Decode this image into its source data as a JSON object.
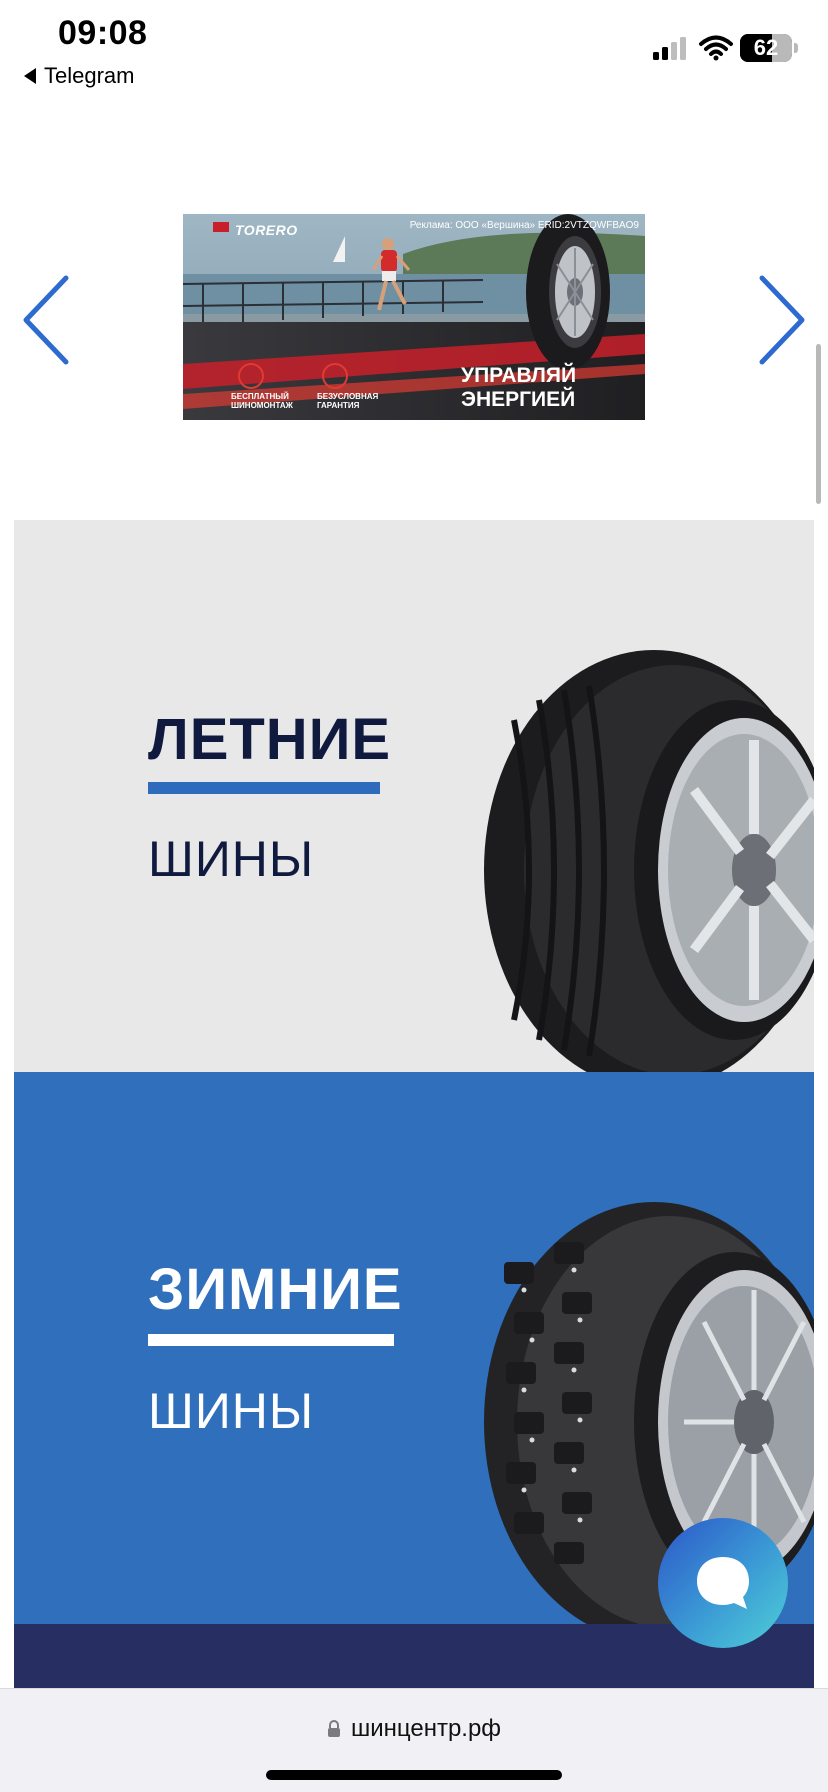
{
  "status_bar": {
    "time": "09:08",
    "back_label": "Telegram",
    "battery_level": "62",
    "icons": [
      "signal-icon",
      "wifi-icon",
      "battery-icon"
    ]
  },
  "carousel": {
    "prev_icon": "chevron-left-icon",
    "next_icon": "chevron-right-icon",
    "banner": {
      "brand": "TORERO",
      "ad_label": "Реклама: ООО «Вершина» ERID:2VTZQWFBAO9",
      "slogan_line1": "УПРАВЛЯЙ",
      "slogan_line2": "ЭНЕРГИЕЙ",
      "badge1_line1": "БЕСПЛАТНЫЙ",
      "badge1_line2": "ШИНОМОНТАЖ",
      "badge2_line1": "БЕЗУСЛОВНАЯ",
      "badge2_line2": "ГАРАНТИЯ"
    }
  },
  "categories": [
    {
      "title": "ЛЕТНИЕ",
      "subtitle": "ШИНЫ",
      "image": "summer-tire-image"
    },
    {
      "title": "ЗИМНИЕ",
      "subtitle": "ШИНЫ",
      "image": "winter-tire-image"
    }
  ],
  "chat_button": {
    "icon": "chat-bubble-icon"
  },
  "browser": {
    "url": "шинцентр.рф",
    "lock_icon": "lock-icon"
  },
  "colors": {
    "accent_blue": "#2e6bbd",
    "winter_bg": "#2f6fbc",
    "summer_bg": "#e8e8e9",
    "title_dark": "#101a3f",
    "footer_strip": "#272f62"
  }
}
